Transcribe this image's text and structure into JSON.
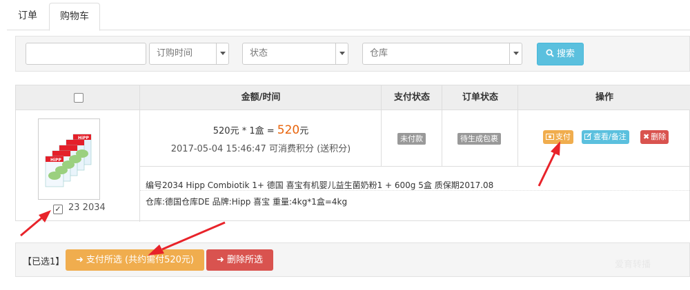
{
  "tabs": [
    {
      "label": "订单",
      "active": false
    },
    {
      "label": "购物车",
      "active": true
    }
  ],
  "filters": {
    "keyword_value": "",
    "order_time_placeholder": "订购时间",
    "status_placeholder": "状态",
    "warehouse_placeholder": "仓库",
    "search_label": "搜索"
  },
  "table": {
    "headers": {
      "amount_time": "金额/时间",
      "pay_status": "支付状态",
      "order_status": "订单状态",
      "actions": "操作"
    },
    "row": {
      "id_label": "23 2034",
      "checked": true,
      "price_formula": "520元 * 1盒 = ",
      "price_total": "520",
      "price_unit": "元",
      "datetime_points": "2017-05-04 15:46:47 可消费积分 (送积分)",
      "pay_status": "未付款",
      "order_status": "待生成包裹",
      "actions": {
        "pay": "支付",
        "view": "查看/备注",
        "delete": "删除"
      },
      "product_desc": "编号2034 Hipp Combiotik 1+ 德国 喜宝有机婴儿益生菌奶粉1 + 600g 5盒 质保期2017.08",
      "product_meta": "仓库:德国仓库DE   品牌:Hipp 喜宝   重量:4kg*1盒=4kg",
      "brand_logo": "HiPP"
    }
  },
  "bottom": {
    "selected_count": "【已选1】",
    "pay_selected": "支付所选 (共约需付520元)",
    "delete_selected": "删除所选",
    "watermark": "爱育转播"
  },
  "colors": {
    "accent_orange": "#f0ad4e",
    "info_blue": "#5bc0de",
    "danger_red": "#d9534f",
    "price_orange": "#e8630a",
    "arrow_red": "#e8232a"
  }
}
